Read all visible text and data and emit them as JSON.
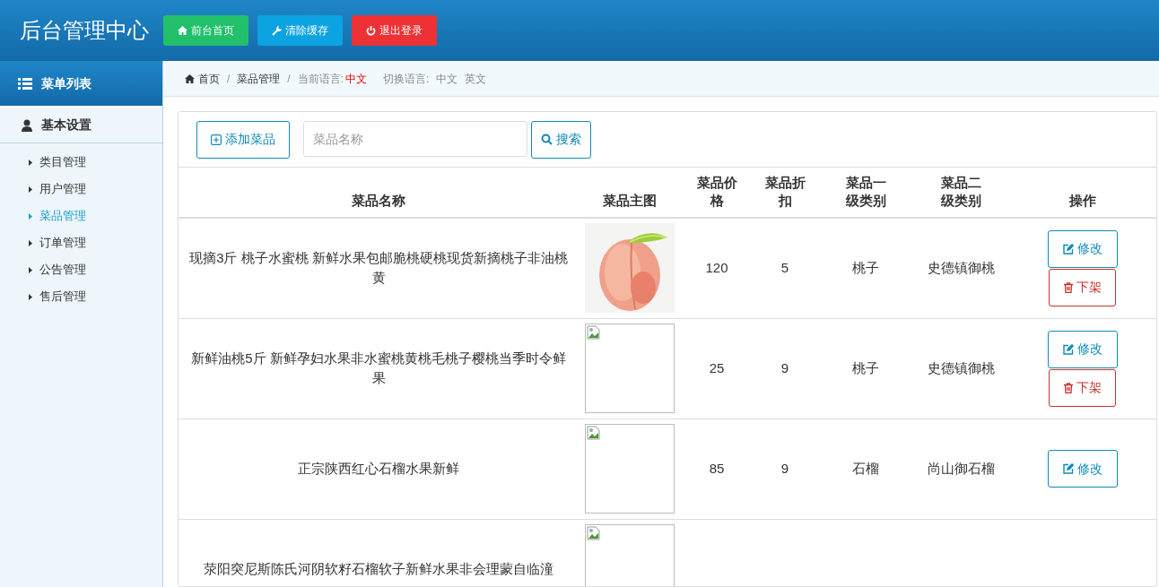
{
  "header": {
    "title": "后台管理中心",
    "buttons": [
      {
        "label": "前台首页",
        "kind": "home"
      },
      {
        "label": "清除缓存",
        "kind": "cache"
      },
      {
        "label": "退出登录",
        "kind": "logout"
      }
    ]
  },
  "sidebar": {
    "heading": "菜单列表",
    "group": "基本设置",
    "items": [
      {
        "label": "类目管理",
        "selected": false
      },
      {
        "label": "用户管理",
        "selected": false
      },
      {
        "label": "菜品管理",
        "selected": true
      },
      {
        "label": "订单管理",
        "selected": false
      },
      {
        "label": "公告管理",
        "selected": false
      },
      {
        "label": "售后管理",
        "selected": false
      }
    ]
  },
  "breadcrumb": {
    "home": "首页",
    "separator": "/",
    "current": "菜品管理",
    "language_label": "当前语言:",
    "language": "中文",
    "switch_label": "切换语言:",
    "languages": [
      "中文",
      "英文"
    ]
  },
  "toolbar": {
    "add_button": "添加菜品",
    "search": {
      "placeholder": "菜品名称"
    },
    "search_button": "搜索"
  },
  "table": {
    "columns": [
      "菜品名称",
      "菜品主图",
      "菜品价格",
      "菜品折扣",
      "菜品一级类别",
      "菜品二级类别",
      "操作"
    ],
    "rows": [
      {
        "name": "现摘3斤 桃子水蜜桃 新鲜水果包邮脆桃硬桃现货新摘桃子非油桃黄",
        "image": {
          "kind": "picture"
        },
        "price": "120",
        "discount": "5",
        "category1": "桃子",
        "category2": "史德镇御桃",
        "actions": [
          "修改",
          "下架"
        ]
      },
      {
        "name": "新鲜油桃5斤 新鲜孕妇水果非水蜜桃黄桃毛桃子樱桃当季时令鲜果",
        "image": {
          "kind": "broken"
        },
        "price": "25",
        "discount": "9",
        "category1": "桃子",
        "category2": "史德镇御桃",
        "actions": [
          "修改",
          "下架"
        ]
      },
      {
        "name": "正宗陕西红心石榴水果新鲜",
        "image": {
          "kind": "broken"
        },
        "price": "85",
        "discount": "9",
        "category1": "石榴",
        "category2": "尚山御石榴",
        "actions": [
          "修改"
        ]
      },
      {
        "name": "荥阳突尼斯陈氏河阴软籽石榴软子新鲜水果非会理蒙自临潼",
        "image": {
          "kind": "broken"
        },
        "actions": []
      }
    ]
  }
}
